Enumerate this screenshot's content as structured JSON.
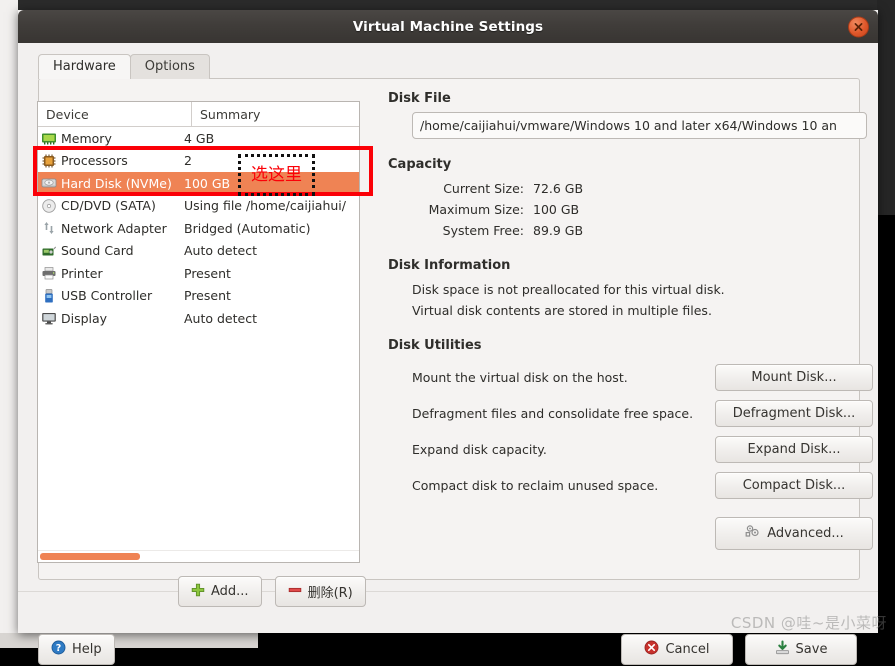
{
  "window": {
    "title": "Virtual Machine Settings",
    "close_icon": "close-icon"
  },
  "tabs": [
    {
      "label": "Hardware",
      "active": true
    },
    {
      "label": "Options",
      "active": false
    }
  ],
  "device_list": {
    "columns": [
      "Device",
      "Summary"
    ],
    "rows": [
      {
        "icon": "memory-icon",
        "device": "Memory",
        "summary": "4 GB",
        "selected": false
      },
      {
        "icon": "processor-icon",
        "device": "Processors",
        "summary": "2",
        "selected": false
      },
      {
        "icon": "harddisk-icon",
        "device": "Hard Disk (NVMe)",
        "summary": "100 GB",
        "selected": true
      },
      {
        "icon": "cddvd-icon",
        "device": "CD/DVD (SATA)",
        "summary": "Using file /home/caijiahui/",
        "selected": false
      },
      {
        "icon": "network-adapter-icon",
        "device": "Network Adapter",
        "summary": "Bridged (Automatic)",
        "selected": false
      },
      {
        "icon": "sound-card-icon",
        "device": "Sound Card",
        "summary": "Auto detect",
        "selected": false
      },
      {
        "icon": "printer-icon",
        "device": "Printer",
        "summary": "Present",
        "selected": false
      },
      {
        "icon": "usb-icon",
        "device": "USB Controller",
        "summary": "Present",
        "selected": false
      },
      {
        "icon": "display-icon",
        "device": "Display",
        "summary": "Auto detect",
        "selected": false
      }
    ],
    "add_label": "Add...",
    "remove_label": "删除(R)"
  },
  "right_pane": {
    "disk_file": {
      "heading": "Disk File",
      "value": "/home/caijiahui/vmware/Windows 10 and later x64/Windows 10 an"
    },
    "capacity": {
      "heading": "Capacity",
      "rows": [
        {
          "label": "Current Size:",
          "value": "72.6 GB"
        },
        {
          "label": "Maximum Size:",
          "value": "100 GB"
        },
        {
          "label": "System Free:",
          "value": "89.9 GB"
        }
      ]
    },
    "disk_information": {
      "heading": "Disk Information",
      "lines": [
        "Disk space is not preallocated for this virtual disk.",
        "Virtual disk contents are stored in multiple files."
      ]
    },
    "disk_utilities": {
      "heading": "Disk Utilities",
      "rows": [
        {
          "text": "Mount the virtual disk on the host.",
          "button": "Mount Disk..."
        },
        {
          "text": "Defragment files and consolidate free space.",
          "button": "Defragment Disk..."
        },
        {
          "text": "Expand disk capacity.",
          "button": "Expand Disk..."
        },
        {
          "text": "Compact disk to reclaim unused space.",
          "button": "Compact Disk..."
        }
      ],
      "advanced_label": "Advanced..."
    }
  },
  "footer": {
    "help_label": "Help",
    "cancel_label": "Cancel",
    "save_label": "Save"
  },
  "annotations": {
    "callout_text": "选这里",
    "highlight_color": "#fb0007",
    "selection_color": "#ef8354"
  },
  "watermark": "CSDN @哇~是小菜呀"
}
